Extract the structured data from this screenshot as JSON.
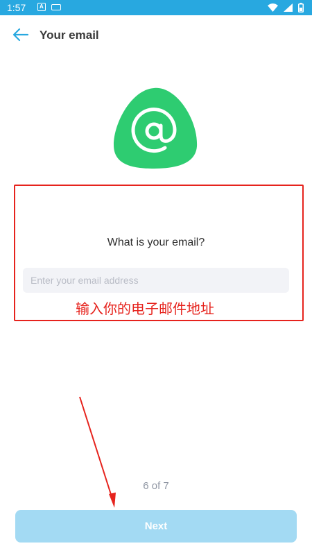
{
  "status_bar": {
    "time": "1:57",
    "icons": [
      "text-a-icon",
      "keyboard-icon",
      "wifi-icon",
      "signal-icon",
      "battery-icon"
    ],
    "color": "#28a8e0"
  },
  "header": {
    "title": "Your email",
    "back_icon": "arrow-left-icon"
  },
  "illustration": {
    "icon": "at-sign-icon",
    "color": "#2ecc71"
  },
  "form": {
    "question": "What is your email?",
    "email_placeholder": "Enter your email address",
    "email_value": ""
  },
  "annotation": {
    "text": "输入你的电子邮件地址",
    "color": "#e6231d"
  },
  "progress": {
    "label": "6 of 7",
    "current": 6,
    "total": 7
  },
  "footer": {
    "next_label": "Next",
    "button_color": "#a3daf3"
  }
}
